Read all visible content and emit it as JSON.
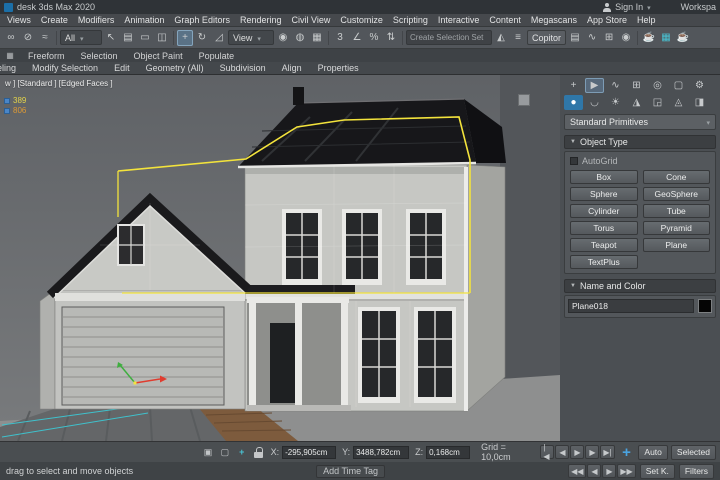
{
  "colors": {
    "selection_yellow": "#f3e33c",
    "gizmo_red": "#e03c2f",
    "gizmo_green": "#3fae3f",
    "teal_accent": "#3fc1cc",
    "render_icon_teal": "#49c3d4",
    "active_category_blue": "#2f77a8",
    "viewport_background": "#6a6d6f"
  },
  "title_bar": {
    "app_title": "desk 3ds Max 2020",
    "sign_in_label": "Sign In",
    "workspaces_label": "Workspa"
  },
  "menu_bar": {
    "items": [
      "Views",
      "Create",
      "Modifiers",
      "Animation",
      "Graph Editors",
      "Rendering",
      "Civil View",
      "Customize",
      "Scripting",
      "Interactive",
      "Content",
      "Megascans",
      "App Store",
      "Help"
    ]
  },
  "toolbar": {
    "icons_link": [
      {
        "name": "select-and-link-icon",
        "glyph": "∞"
      },
      {
        "name": "unlink-selection-icon",
        "glyph": "⊘"
      },
      {
        "name": "bind-to-space-warp-icon",
        "glyph": "≈"
      }
    ],
    "selection_filter_value": "All",
    "icons_select": [
      {
        "name": "select-object-icon",
        "glyph": "↖"
      },
      {
        "name": "select-by-name-icon",
        "glyph": "▤"
      },
      {
        "name": "rectangular-selection-region-icon",
        "glyph": "▭"
      },
      {
        "name": "window-crossing-toggle-icon",
        "glyph": "◫"
      }
    ],
    "icons_transform": [
      {
        "name": "select-and-move-icon",
        "glyph": "+",
        "active": true
      },
      {
        "name": "select-and-rotate-icon",
        "glyph": "↻"
      },
      {
        "name": "select-and-scale-icon",
        "glyph": "◿"
      }
    ],
    "reference_coordinate_system_value": "View",
    "icons_pivot": [
      {
        "name": "use-pivot-point-center-icon",
        "glyph": "◉"
      },
      {
        "name": "select-and-manipulate-icon",
        "glyph": "◍"
      },
      {
        "name": "keyboard-shortcut-override-icon",
        "glyph": "▦"
      }
    ],
    "icons_snap": [
      {
        "name": "snaps-toggle-3d-icon",
        "glyph": "3"
      },
      {
        "name": "angle-snap-toggle-icon",
        "glyph": "∠"
      },
      {
        "name": "percent-snap-toggle-icon",
        "glyph": "%"
      },
      {
        "name": "spinner-snap-toggle-icon",
        "glyph": "⇅"
      }
    ],
    "named_selection_set_value": "Create Selection Set",
    "icons_mirror_align": [
      {
        "name": "mirror-icon",
        "glyph": "◭"
      },
      {
        "name": "align-icon",
        "glyph": "≡"
      }
    ],
    "copitor_label": "Copitor",
    "icons_editors": [
      {
        "name": "scene-explorer-icon",
        "glyph": "▤"
      },
      {
        "name": "curve-editor-icon",
        "glyph": "∿"
      },
      {
        "name": "schematic-view-icon",
        "glyph": "⊞"
      },
      {
        "name": "material-editor-icon",
        "glyph": "◉"
      }
    ],
    "icons_render": [
      {
        "name": "render-setup-icon",
        "glyph": "☕"
      },
      {
        "name": "rendered-frame-window-icon",
        "glyph": "▦"
      },
      {
        "name": "render-production-icon",
        "glyph": "☕"
      }
    ]
  },
  "ribbon": {
    "tabs": [
      {
        "name": "ribbon-tab-freeform",
        "label": "Freeform"
      },
      {
        "name": "ribbon-tab-selection",
        "label": "Selection"
      },
      {
        "name": "ribbon-tab-object-paint",
        "label": "Object Paint"
      },
      {
        "name": "ribbon-tab-populate",
        "label": "Populate"
      }
    ],
    "panels": [
      {
        "name": "ribbon-panel-modeling",
        "label": "deling"
      },
      {
        "name": "ribbon-panel-modify-selection",
        "label": "Modify Selection"
      },
      {
        "name": "ribbon-panel-edit",
        "label": "Edit"
      },
      {
        "name": "ribbon-panel-geometry-all",
        "label": "Geometry (All)"
      },
      {
        "name": "ribbon-panel-subdivision",
        "label": "Subdivision"
      },
      {
        "name": "ribbon-panel-align",
        "label": "Align"
      },
      {
        "name": "ribbon-panel-properties",
        "label": "Properties"
      }
    ]
  },
  "viewport": {
    "label": "w ]  [Standard ]  [Edged Faces ]",
    "stat_top": "389",
    "stat_bottom": "806"
  },
  "command_panel": {
    "tabs": [
      {
        "name": "panel-plus-icon",
        "glyph": "+"
      },
      {
        "name": "create-tab-icon",
        "glyph": "▶",
        "active": true
      },
      {
        "name": "modify-tab-icon",
        "glyph": "∿"
      },
      {
        "name": "hierarchy-tab-icon",
        "glyph": "⊞"
      },
      {
        "name": "motion-tab-icon",
        "glyph": "◎"
      },
      {
        "name": "display-tab-icon",
        "glyph": "▢"
      },
      {
        "name": "utilities-tab-icon",
        "glyph": "⚙"
      }
    ],
    "categories": [
      {
        "name": "geometry-category-icon",
        "glyph": "●",
        "active": true
      },
      {
        "name": "shapes-category-icon",
        "glyph": "◡"
      },
      {
        "name": "lights-category-icon",
        "glyph": "☀"
      },
      {
        "name": "cameras-category-icon",
        "glyph": "◮"
      },
      {
        "name": "helpers-category-icon",
        "glyph": "◲"
      },
      {
        "name": "space-warps-category-icon",
        "glyph": "◬"
      },
      {
        "name": "systems-category-icon",
        "glyph": "◨"
      }
    ],
    "subcategory_dropdown_value": "Standard Primitives",
    "object_type_rollout_label": "Object Type",
    "autogrid_label": "AutoGrid",
    "object_buttons": [
      {
        "name": "box-button",
        "label": "Box"
      },
      {
        "name": "cone-button",
        "label": "Cone"
      },
      {
        "name": "sphere-button",
        "label": "Sphere"
      },
      {
        "name": "geosphere-button",
        "label": "GeoSphere"
      },
      {
        "name": "cylinder-button",
        "label": "Cylinder"
      },
      {
        "name": "tube-button",
        "label": "Tube"
      },
      {
        "name": "torus-button",
        "label": "Torus"
      },
      {
        "name": "pyramid-button",
        "label": "Pyramid"
      },
      {
        "name": "teapot-button",
        "label": "Teapot"
      },
      {
        "name": "plane-button",
        "label": "Plane"
      },
      {
        "name": "textplus-button",
        "label": "TextPlus"
      }
    ],
    "name_color_rollout_label": "Name and Color",
    "object_name_value": "Plane018"
  },
  "bottom_bar": {
    "x_label": "X:",
    "x_value": "-295,905cm",
    "y_label": "Y:",
    "y_value": "3488,782cm",
    "z_label": "Z:",
    "z_value": "0,168cm",
    "grid_label": "Grid = 10,0cm",
    "transport_top": [
      {
        "name": "go-to-start-button",
        "glyph": "|◀"
      },
      {
        "name": "previous-frame-button",
        "glyph": "◀"
      },
      {
        "name": "play-animation-button",
        "glyph": "▶"
      },
      {
        "name": "next-frame-button",
        "glyph": "▶"
      },
      {
        "name": "go-to-end-button",
        "glyph": "▶|"
      }
    ],
    "auto_key_label": "Auto",
    "selected_label": "Selected"
  },
  "status_bar": {
    "prompt": "drag to select and move objects",
    "add_time_tag_label": "Add Time Tag",
    "transport_bottom": [
      {
        "name": "key-step-start-button",
        "glyph": "◀◀"
      },
      {
        "name": "previous-key-button",
        "glyph": "◀"
      },
      {
        "name": "next-key-button",
        "glyph": "▶"
      },
      {
        "name": "key-step-end-button",
        "glyph": "▶▶"
      }
    ],
    "set_key_label": "Set K.",
    "key_filters_label": "Filters"
  }
}
